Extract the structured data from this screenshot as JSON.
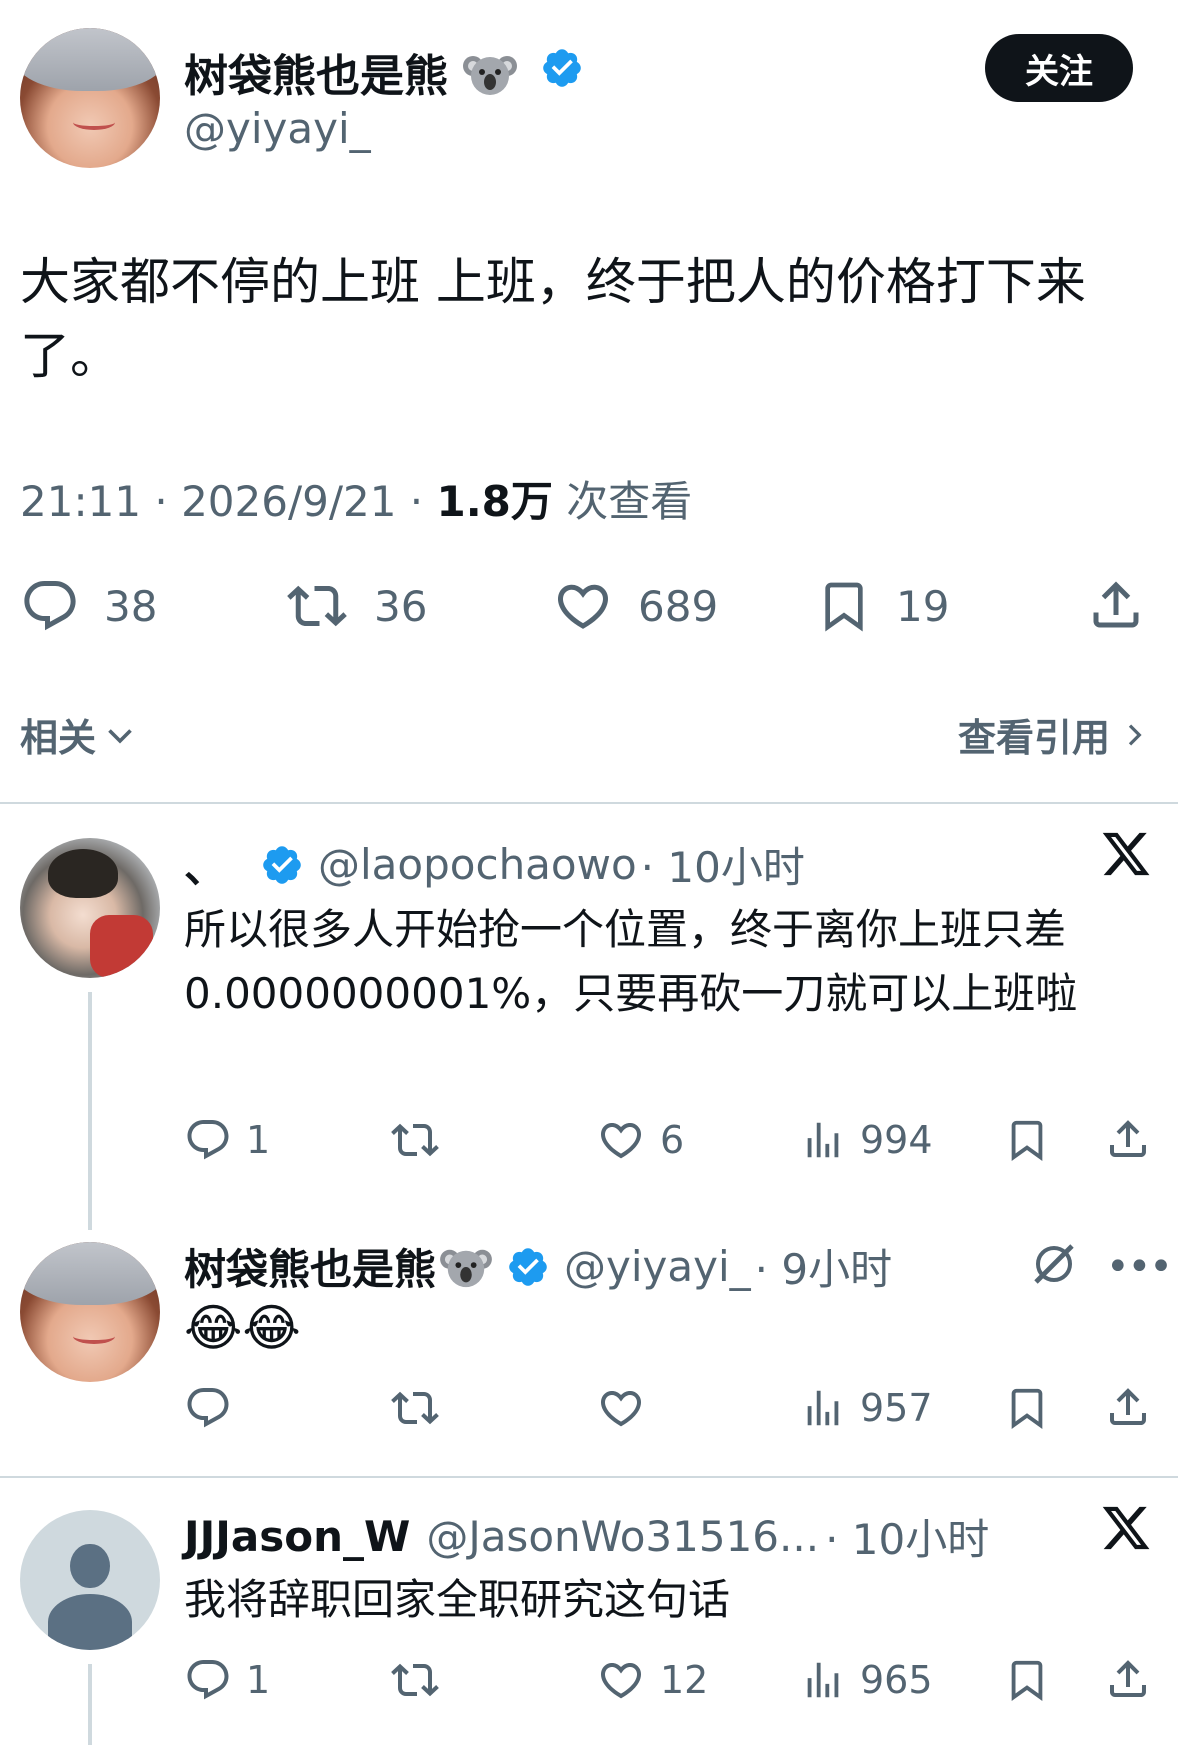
{
  "main_tweet": {
    "author_name": "树袋熊也是熊",
    "author_handle": "@yiyayi_",
    "follow_label": "关注",
    "text": "大家都不停的上班 上班，终于把人的价格打下来了。",
    "time": "21:11 · 2026/9/21 · ",
    "views_count": "1.8万",
    "views_label": " 次查看",
    "replies": "38",
    "retweets": "36",
    "likes": "689",
    "bookmarks": "19"
  },
  "related_label": "相关",
  "view_quotes_label": "查看引用",
  "replies": [
    {
      "author_name": "、",
      "author_handle": "@laopochaowo",
      "time": "· 10小时",
      "text": "所以很多人开始抢一个位置，终于离你上班只差0.0000000001%，只要再砍一刀就可以上班啦",
      "replies": "1",
      "retweets": "",
      "likes": "6",
      "views": "994"
    },
    {
      "author_name": "树袋熊也是熊",
      "author_handle": "@yiyayi_",
      "time": "· 9小时",
      "text": "😂😂",
      "replies": "",
      "retweets": "",
      "likes": "",
      "views": "957"
    },
    {
      "author_name": "JJJason_W",
      "author_handle": "@JasonWo31516...",
      "time": "· 10小时",
      "text": "我将辞职回家全职研究这句话",
      "replies": "1",
      "retweets": "",
      "likes": "12",
      "views": "965"
    }
  ],
  "colors": {
    "text": "#0f1419",
    "secondary": "#536471",
    "verified": "#1d9bf0",
    "divider": "#cfd9de"
  }
}
